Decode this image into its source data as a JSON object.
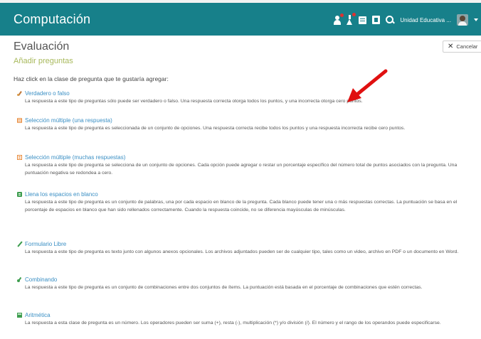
{
  "app": {
    "title": "Computación"
  },
  "topbar": {
    "institution_label": "Unidad Educativa ...",
    "icons": [
      "user-icon",
      "flask-icon",
      "grid-icon",
      "book-icon",
      "search-icon",
      "avatar",
      "chevron-down-icon"
    ],
    "notification_color": "#e03030"
  },
  "page": {
    "title": "Evaluación",
    "subtitle": "Añadir preguntas",
    "cancel_label": "Cancelar",
    "instruction": "Haz click en la clase de pregunta que te gustaría agregar:"
  },
  "question_types": [
    {
      "name": "Verdadero o falso",
      "icon": "true-false-icon",
      "description": "La respuesta a este tipo de preguntas sólo puede ser verdadero o falso. Una respuesta correcta otorga todos los puntos, y una incorrecta otorga cero puntos."
    },
    {
      "name": "Selección múltiple (una respuesta)",
      "icon": "single-choice-icon",
      "description": "La respuesta a este tipo de pregunta es seleccionada de un conjunto de opciones. Una respuesta correcta recibe todos los puntos y una respuesta incorrecta recibe cero puntos."
    },
    {
      "name": "Selección múltiple (muchas respuestas)",
      "icon": "multi-choice-icon",
      "description": "La respuesta a este tipo de pregunta se selecciona de un conjunto de opciones. Cada opción puede agregar o restar un porcentaje específico del número total de puntos asociados con la pregunta. Una puntuación negativa se redondea a cero."
    },
    {
      "name": "Llena los espacios en blanco",
      "icon": "fill-blanks-icon",
      "description": "La respuesta a este tipo de pregunta es un conjunto de palabras, una por cada espacio en blanco de la pregunta. Cada blanco puede tener una o más respuestas correctas. La puntuación se basa en el porcentaje de espacios en blanco que han sido rellenados correctamente. Cuando la respuesta coincide, no se diferencia mayúsculas de minúsculas."
    },
    {
      "name": "Formulario Libre",
      "icon": "pencil-icon",
      "description": "La respuesta a este tipo de pregunta es texto junto con algunos anexos opcionales. Los archivos adjuntados pueden ser de cualquier tipo, tales como un video, archivo en PDF o un documento en Word."
    },
    {
      "name": "Combinando",
      "icon": "matching-icon",
      "description": "La respuesta a este tipo de pregunta es un conjunto de combinaciones entre dos conjuntos de ítems. La puntuación está basada en el porcentaje de combinaciones que estén correctas."
    },
    {
      "name": "Aritmética",
      "icon": "calculator-icon",
      "description": "La respuesta a esta clase de pregunta es un número. Los operadores pueden ser suma (+), resta (-), multiplicación (*) y/o división (/). El número y el rango de los operandos puede especificarse."
    }
  ],
  "colors": {
    "topbar": "#17808a",
    "link": "#3a8fc4",
    "subtitle": "#a8b95c",
    "arrow": "#e01010"
  }
}
